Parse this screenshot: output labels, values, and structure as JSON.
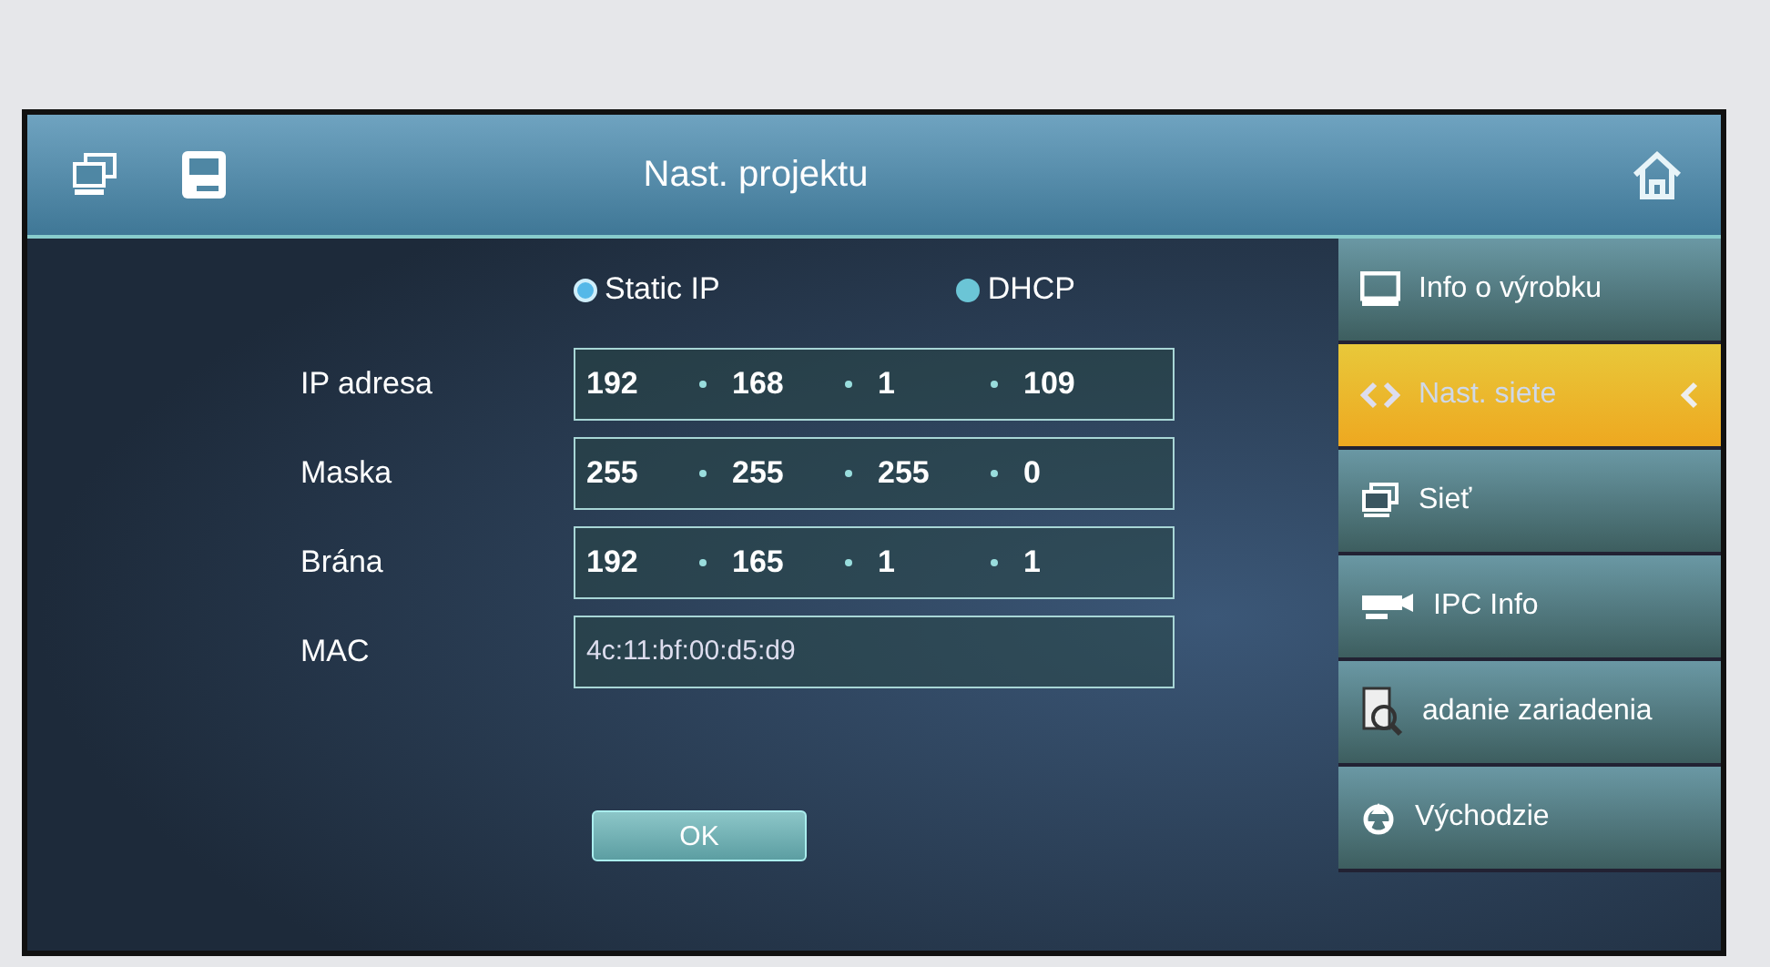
{
  "header": {
    "title": "Nast. projektu"
  },
  "modes": [
    {
      "label": "Static IP",
      "selected": true
    },
    {
      "label": "DHCP",
      "selected": false
    }
  ],
  "fields": [
    {
      "label": "IP adresa",
      "kind": "ip",
      "octets": [
        "192",
        "168",
        "1",
        "109"
      ]
    },
    {
      "label": "Maska",
      "kind": "ip",
      "octets": [
        "255",
        "255",
        "255",
        "0"
      ]
    },
    {
      "label": "Brána",
      "kind": "ip",
      "octets": [
        "192",
        "165",
        "1",
        "1"
      ]
    },
    {
      "label": "MAC",
      "kind": "text",
      "value": "4c:11:bf:00:d5:d9"
    }
  ],
  "ok_button": "OK",
  "menu": [
    {
      "label": "Info o výrobku",
      "selected": false
    },
    {
      "label": "Nast. siete",
      "selected": true
    },
    {
      "label": "Sieť",
      "selected": false
    },
    {
      "label": "IPC Info",
      "selected": false
    },
    {
      "label": "adanie zariadenia",
      "selected": false
    },
    {
      "label": "Východzie",
      "selected": false
    }
  ]
}
